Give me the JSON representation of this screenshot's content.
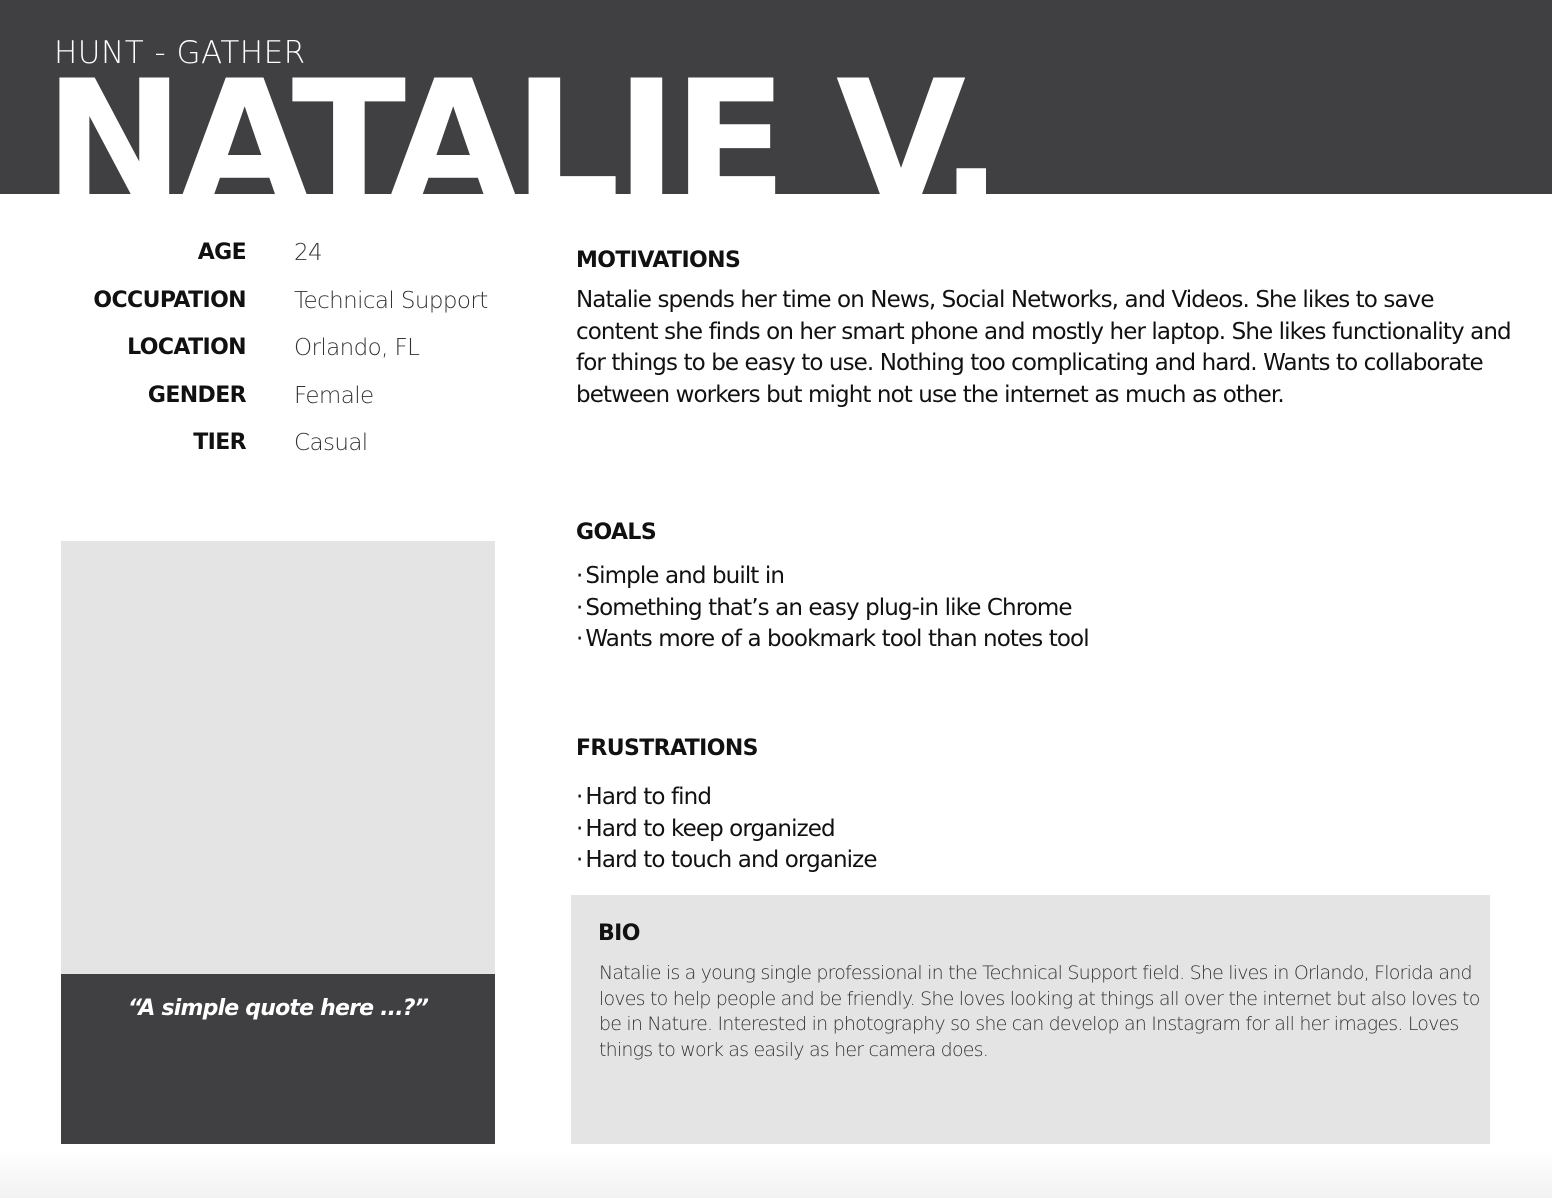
{
  "header": {
    "subtitle": "HUNT - GATHER",
    "name": "NATALIE V."
  },
  "info": [
    {
      "label": "AGE",
      "value": "24"
    },
    {
      "label": "OCCUPATION",
      "value": "Technical Support"
    },
    {
      "label": "LOCATION",
      "value": "Orlando, FL"
    },
    {
      "label": "GENDER",
      "value": "Female"
    },
    {
      "label": "TIER",
      "value": "Casual"
    }
  ],
  "quote": "“A simple quote here ...?”",
  "motivations": {
    "title": "MOTIVATIONS",
    "text": "Natalie spends her time on News, Social Networks, and Videos. She likes to save content she finds on her smart phone and mostly her laptop. She likes functionality and for things to be easy to use. Nothing too complicating and hard. Wants to collaborate between workers but might not use the internet as much as other."
  },
  "goals": {
    "title": "GOALS",
    "bullet": "·",
    "items": [
      "Simple and built in",
      "Something that’s an easy plug-in like Chrome",
      "Wants more of a bookmark tool than notes tool"
    ]
  },
  "frustrations": {
    "title": "FRUSTRATIONS",
    "bullet": "·",
    "items": [
      "Hard to find",
      "Hard to keep organized",
      "Hard to touch and organize"
    ]
  },
  "bio": {
    "title": "BIO",
    "text": "Natalie is a young single professional in the Technical Support field. She lives in Orlando, Florida and loves to help people and be friendly.  She loves looking at things all over the internet but also loves to be in Nature. Interested in photography so she can develop an Instagram for all her images. Loves things to work as easily as her camera does."
  },
  "colors": {
    "header_bg": "#404042",
    "panel_bg": "#e4e4e4"
  }
}
